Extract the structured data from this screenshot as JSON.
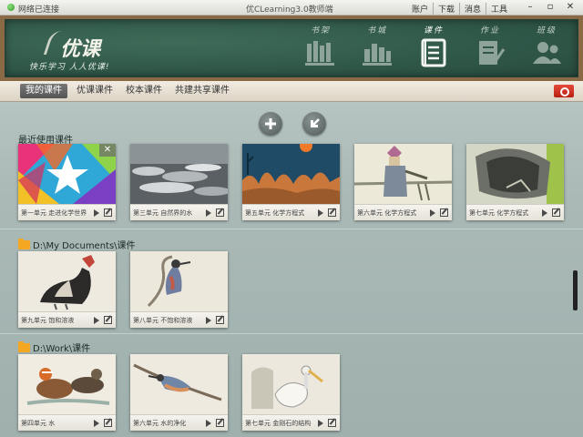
{
  "titlebar": {
    "network_status": "网络已连接",
    "app_title": "优CLearning3.0教师端",
    "menu": [
      "账户",
      "下载",
      "消息",
      "工具"
    ],
    "window_buttons": [
      "minimize-icon",
      "restore-icon",
      "close-icon"
    ]
  },
  "header": {
    "logo_text": "优课",
    "slogan": "快乐学习 人人优课!",
    "nav": [
      {
        "label": "书架",
        "icon": "bookshelf-icon",
        "active": false
      },
      {
        "label": "书城",
        "icon": "bookstore-icon",
        "active": false
      },
      {
        "label": "课件",
        "icon": "courseware-icon",
        "active": true
      },
      {
        "label": "作业",
        "icon": "homework-icon",
        "active": false
      },
      {
        "label": "班级",
        "icon": "class-icon",
        "active": false
      }
    ]
  },
  "tabs": [
    "我的课件",
    "优课课件",
    "校本课件",
    "共建共享课件"
  ],
  "active_tab": "我的课件",
  "actions": {
    "add_icon": "plus-icon",
    "import_icon": "import-arrow-icon"
  },
  "sections": [
    {
      "title": "最近使用课件",
      "cards": [
        {
          "label": "第一单元 走进化学世界",
          "thumb": "colorful-star"
        },
        {
          "label": "第三单元 自然界的水",
          "thumb": "water"
        },
        {
          "label": "第五单元 化学方程式",
          "thumb": "coral-sunset"
        },
        {
          "label": "第六单元 化学方程式",
          "thumb": "figure-sketch"
        },
        {
          "label": "第七单元 化学方程式",
          "thumb": "bucket-sketch"
        }
      ]
    },
    {
      "title": "D:\\My Documents\\课件",
      "cards": [
        {
          "label": "第九单元 饱和溶液",
          "thumb": "vulture"
        },
        {
          "label": "第八单元 不饱和溶液",
          "thumb": "bird-branch"
        }
      ]
    },
    {
      "title": "D:\\Work\\课件",
      "cards": [
        {
          "label": "第四单元 水",
          "thumb": "mandarin-duck"
        },
        {
          "label": "第六单元 水的净化",
          "thumb": "nuthatch"
        },
        {
          "label": "第七单元 金刚石的结构",
          "thumb": "pelican"
        }
      ]
    }
  ],
  "colors": {
    "accent_red": "#c8261a",
    "folder": "#f4a822",
    "board_green": "#2f5748"
  }
}
